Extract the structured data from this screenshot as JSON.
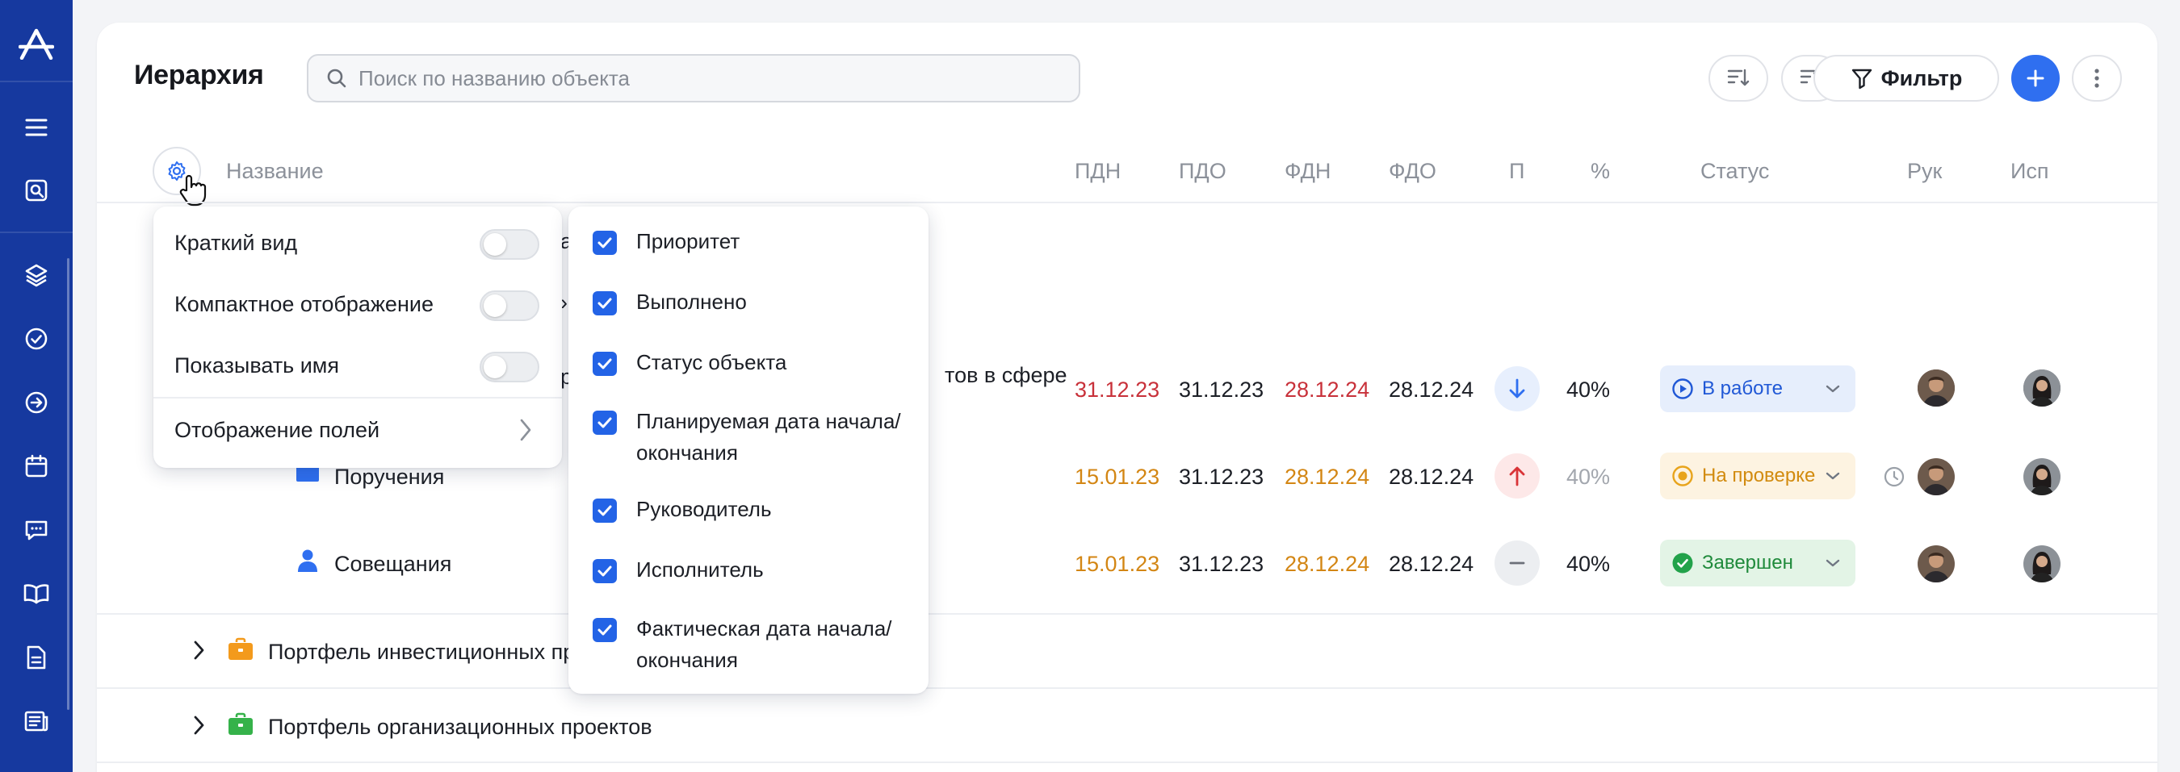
{
  "sidebar": {
    "logo": "A",
    "icons": [
      "menu-icon",
      "search-screen-icon",
      "layers-icon",
      "check-circle-icon",
      "arrow-right-circle-icon",
      "calendar-icon",
      "chat-icon",
      "book-icon",
      "document-icon",
      "news-icon"
    ]
  },
  "header": {
    "title": "Иерархия",
    "search_placeholder": "Поиск по названию объекта",
    "filter_label": "Фильтр"
  },
  "columns": {
    "name": "Название",
    "pdn": "ПДН",
    "pdo": "ПДО",
    "fdn": "ФДН",
    "fdo": "ФДО",
    "p": "П",
    "percent": "%",
    "status": "Статус",
    "ruk": "Рук",
    "isp": "Исп"
  },
  "rows": [
    {
      "name_fragment": "тов в сфере",
      "pdn": "31.12.23",
      "pdo": "31.12.23",
      "fdn": "28.12.24",
      "fdo": "28.12.24",
      "priority": "low",
      "percent": "40%",
      "status": "В работе"
    },
    {
      "name": "Поручения",
      "pdn": "15.01.23",
      "pdo": "31.12.23",
      "fdn": "28.12.24",
      "fdo": "28.12.24",
      "priority": "high",
      "percent": "40%",
      "status": "На проверке"
    },
    {
      "name": "Совещания",
      "pdn": "15.01.23",
      "pdo": "31.12.23",
      "fdn": "28.12.24",
      "fdo": "28.12.24",
      "priority": "none",
      "percent": "40%",
      "status": "Завершен"
    }
  ],
  "portfolios": [
    {
      "name": "Портфель инвестиционных про",
      "icon_color": "#f39a1c"
    },
    {
      "name": "Портфель организационных проектов",
      "icon_color": "#35b24a"
    }
  ],
  "settings_menu": {
    "items": [
      {
        "label": "Краткий вид",
        "enabled": false
      },
      {
        "label": "Компактное отображение",
        "enabled": false
      },
      {
        "label": "Показывать имя",
        "enabled": false
      }
    ],
    "fields_label": "Отображение полей"
  },
  "field_options": [
    {
      "label": "Приоритет",
      "checked": true
    },
    {
      "label": "Выполнено",
      "checked": true
    },
    {
      "label": "Статус объекта",
      "checked": true
    },
    {
      "label": "Планируемая дата начала/ окончания",
      "checked": true
    },
    {
      "label": "Руководитель",
      "checked": true
    },
    {
      "label": "Исполнитель",
      "checked": true
    },
    {
      "label": "Фактическая дата начала/ окончания",
      "checked": true
    }
  ],
  "colors": {
    "sidebar": "#16399f",
    "accent": "#2f6ff0",
    "date_overdue": "#c8313a",
    "date_warning": "#d38614"
  }
}
